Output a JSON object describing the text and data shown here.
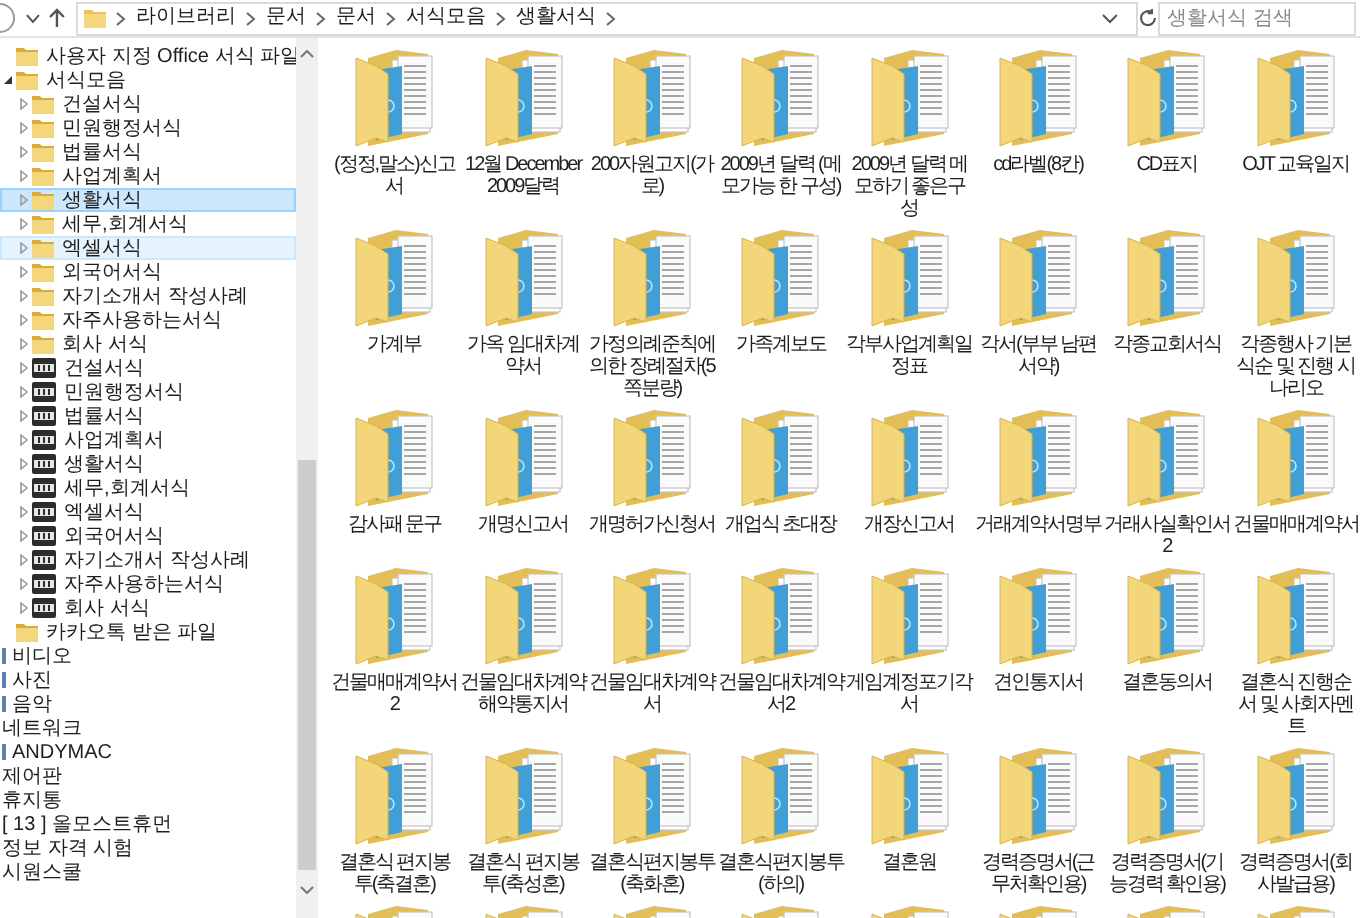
{
  "address_bar": {
    "crumbs": [
      "라이브러리",
      "문서",
      "문서",
      "서식모음",
      "생활서식"
    ]
  },
  "search": {
    "placeholder": "생활서식 검색"
  },
  "sidebar": {
    "tree": [
      {
        "label": "사용자 지정 Office 서식 파일",
        "kind": "folder",
        "selected": false,
        "hovered": false
      },
      {
        "label": "서식모음",
        "kind": "folder",
        "expanded": true,
        "selected": false,
        "hovered": false,
        "children": [
          {
            "label": "건설서식",
            "kind": "folder",
            "expanded": false,
            "selected": false,
            "hovered": false
          },
          {
            "label": "민원행정서식",
            "kind": "folder",
            "expanded": false,
            "selected": false,
            "hovered": false
          },
          {
            "label": "법률서식",
            "kind": "folder",
            "expanded": false,
            "selected": false,
            "hovered": false
          },
          {
            "label": "사업계획서",
            "kind": "folder",
            "expanded": false,
            "selected": false,
            "hovered": false
          },
          {
            "label": "생활서식",
            "kind": "folder",
            "expanded": false,
            "selected": true,
            "hovered": false
          },
          {
            "label": "세무,회계서식",
            "kind": "folder",
            "expanded": false,
            "selected": false,
            "hovered": false
          },
          {
            "label": "엑셀서식",
            "kind": "folder",
            "expanded": false,
            "selected": false,
            "hovered": true
          },
          {
            "label": "외국어서식",
            "kind": "folder",
            "expanded": false,
            "selected": false,
            "hovered": false
          },
          {
            "label": "자기소개서 작성사례",
            "kind": "folder",
            "expanded": false,
            "selected": false,
            "hovered": false
          },
          {
            "label": "자주사용하는서식",
            "kind": "folder",
            "expanded": false,
            "selected": false,
            "hovered": false
          },
          {
            "label": "회사 서식",
            "kind": "folder",
            "expanded": false,
            "selected": false,
            "hovered": false
          },
          {
            "label": "건설서식",
            "kind": "zip",
            "expanded": false,
            "selected": false,
            "hovered": false
          },
          {
            "label": "민원행정서식",
            "kind": "zip",
            "expanded": false,
            "selected": false,
            "hovered": false
          },
          {
            "label": "법률서식",
            "kind": "zip",
            "expanded": false,
            "selected": false,
            "hovered": false
          },
          {
            "label": "사업계획서",
            "kind": "zip",
            "expanded": false,
            "selected": false,
            "hovered": false
          },
          {
            "label": "생활서식",
            "kind": "zip",
            "expanded": false,
            "selected": false,
            "hovered": false
          },
          {
            "label": "세무,회계서식",
            "kind": "zip",
            "expanded": false,
            "selected": false,
            "hovered": false
          },
          {
            "label": "엑셀서식",
            "kind": "zip",
            "expanded": false,
            "selected": false,
            "hovered": false
          },
          {
            "label": "외국어서식",
            "kind": "zip",
            "expanded": false,
            "selected": false,
            "hovered": false
          },
          {
            "label": "자기소개서 작성사례",
            "kind": "zip",
            "expanded": false,
            "selected": false,
            "hovered": false
          },
          {
            "label": "자주사용하는서식",
            "kind": "zip",
            "expanded": false,
            "selected": false,
            "hovered": false
          },
          {
            "label": "회사 서식",
            "kind": "zip",
            "expanded": false,
            "selected": false,
            "hovered": false
          }
        ]
      },
      {
        "label": "카카오톡 받은 파일",
        "kind": "folder",
        "selected": false,
        "hovered": false
      },
      {
        "label": "비디오",
        "kind": "library",
        "selected": false,
        "hovered": false
      },
      {
        "label": "사진",
        "kind": "library",
        "selected": false,
        "hovered": false
      },
      {
        "label": "음악",
        "kind": "library",
        "selected": false,
        "hovered": false
      },
      {
        "label": "네트워크",
        "kind": "place",
        "selected": false,
        "hovered": false
      },
      {
        "label": "ANDYMAC",
        "kind": "library",
        "selected": false,
        "hovered": false
      },
      {
        "label": "제어판",
        "kind": "place",
        "selected": false,
        "hovered": false
      },
      {
        "label": "휴지통",
        "kind": "place",
        "selected": false,
        "hovered": false
      },
      {
        "label": "[ 13 ] 올모스트휴먼",
        "kind": "place",
        "selected": false,
        "hovered": false
      },
      {
        "label": "정보 자격 시험",
        "kind": "place",
        "selected": false,
        "hovered": false
      },
      {
        "label": "시원스쿨",
        "kind": "place",
        "selected": false,
        "hovered": false
      }
    ]
  },
  "files": [
    {
      "label": "(정정,말소)신고서"
    },
    {
      "label": "12월 December 2009달력"
    },
    {
      "label": "200자원고지(가로)"
    },
    {
      "label": "2009년 달력 (메모가능 한 구성)"
    },
    {
      "label": "2009년 달력 메모하기 좋은구성"
    },
    {
      "label": "cd라벨(8칸)"
    },
    {
      "label": "CD표지"
    },
    {
      "label": "OJT 교육일지"
    },
    {
      "label": "가계부"
    },
    {
      "label": "가옥 임대차계약서"
    },
    {
      "label": "가정의례준칙에 의한 장례절차(5쪽분량)"
    },
    {
      "label": "가족계보도"
    },
    {
      "label": "각부사업계획일정표"
    },
    {
      "label": "각서(부부 남편서약)"
    },
    {
      "label": "각종교회서식"
    },
    {
      "label": "각종행사 기본식순 및 진행 시나리오"
    },
    {
      "label": "감사패 문구"
    },
    {
      "label": "개명신고서"
    },
    {
      "label": "개명허가신청서"
    },
    {
      "label": "개업식 초대장"
    },
    {
      "label": "개장신고서"
    },
    {
      "label": "거래계약서명부"
    },
    {
      "label": "거래사실확인서2"
    },
    {
      "label": "건물매매계약서"
    },
    {
      "label": "건물매매계약서2"
    },
    {
      "label": "건물임대차계약해약통지서"
    },
    {
      "label": "건물임대차계약서"
    },
    {
      "label": "건물임대차계약서2"
    },
    {
      "label": "게임계정포기각서"
    },
    {
      "label": "견인통지서"
    },
    {
      "label": "결혼동의서"
    },
    {
      "label": "결혼식 진행순서 및 사회자멘트"
    },
    {
      "label": "결혼식 편지봉투(축결혼)"
    },
    {
      "label": "결혼식 편지봉투(축성혼)"
    },
    {
      "label": "결혼식편지봉투(축화혼)"
    },
    {
      "label": "결혼식편지봉투(하의)"
    },
    {
      "label": "결혼원"
    },
    {
      "label": "경력증명서(근무처확인용)"
    },
    {
      "label": "경력증명서(기능경력 확인용)"
    },
    {
      "label": "경력증명서(회사발급용)"
    },
    {
      "kind": "cut"
    },
    {
      "kind": "cut"
    },
    {
      "kind": "cut"
    },
    {
      "kind": "cut"
    },
    {
      "kind": "cut"
    },
    {
      "kind": "cut"
    },
    {
      "kind": "cut"
    },
    {
      "kind": "cut"
    }
  ]
}
